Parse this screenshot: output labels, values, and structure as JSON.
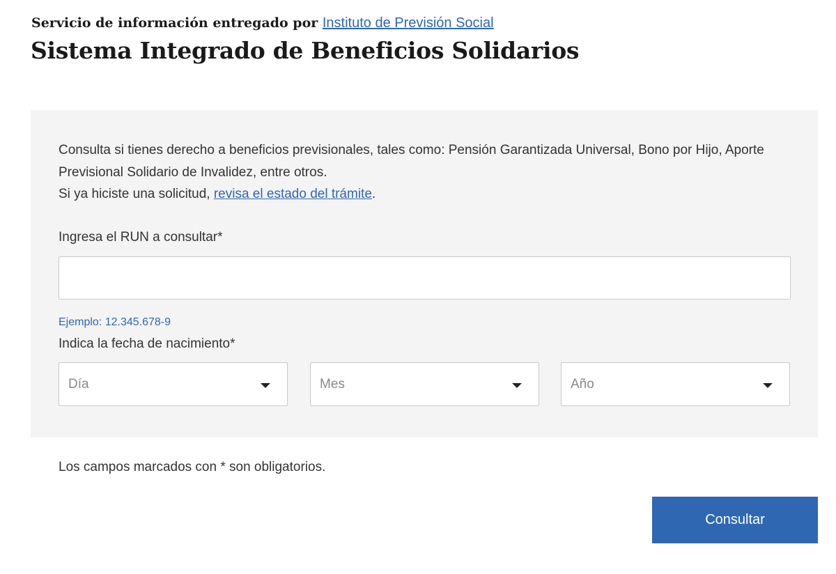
{
  "header": {
    "provider_prefix": "Servicio de información entregado por",
    "provider_link": "Instituto de Previsión Social",
    "title": "Sistema Integrado de Beneficios Solidarios"
  },
  "panel": {
    "intro_text": "Consulta si tienes derecho a beneficios previsionales, tales como: Pensión Garantizada Universal, Bono por Hijo, Aporte Previsional Solidario de Invalidez, entre otros.",
    "status_prefix": "Si ya hiciste una solicitud,",
    "status_link": "revisa el estado del trámite",
    "status_suffix": ".",
    "run_label": "Ingresa el RUN a consultar*",
    "run_value": "",
    "run_hint": "Ejemplo: 12.345.678-9",
    "birthdate_label": "Indica la fecha de nacimiento*",
    "day_placeholder": "Día",
    "month_placeholder": "Mes",
    "year_placeholder": "Año"
  },
  "footer": {
    "required_note": "Los campos marcados con * son obligatorios.",
    "submit_label": "Consultar"
  },
  "colors": {
    "accent": "#2f67b3",
    "panel_bg": "#f4f4f4",
    "text": "#333333"
  },
  "icons": {
    "select_caret": "chevron-down-icon"
  }
}
